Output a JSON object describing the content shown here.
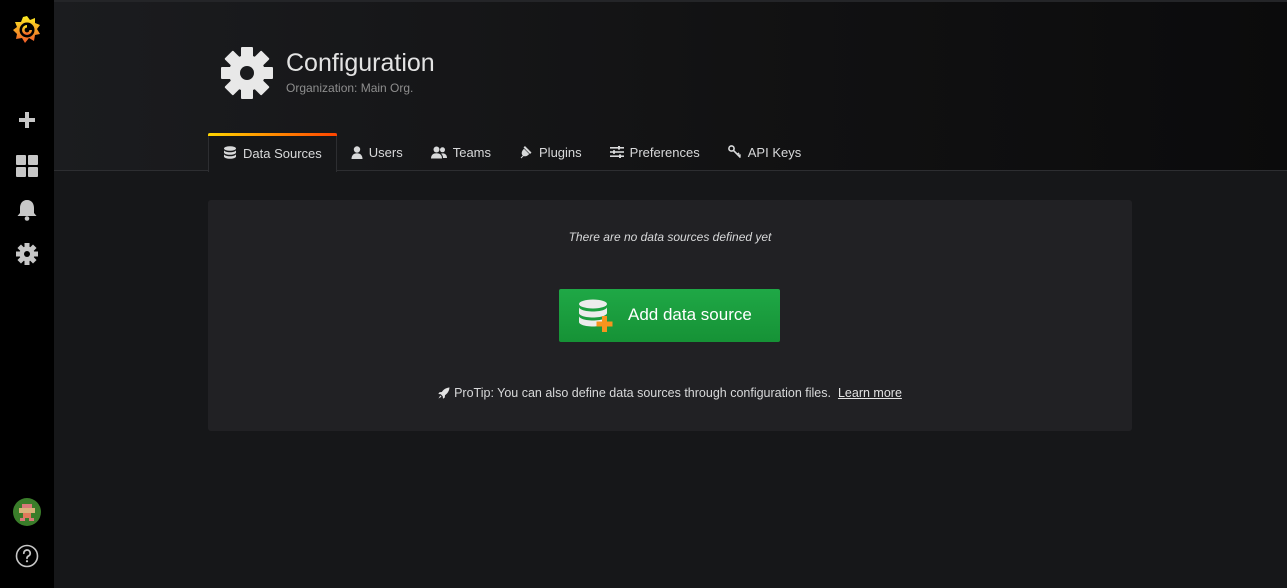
{
  "sidebar": {
    "logo_icon": "grafana-logo-icon",
    "items": [
      {
        "name": "create",
        "icon": "plus-icon"
      },
      {
        "name": "dashboards",
        "icon": "apps-icon"
      },
      {
        "name": "alerting",
        "icon": "bell-icon"
      },
      {
        "name": "configuration",
        "icon": "gear-icon"
      }
    ],
    "bottom": [
      {
        "name": "profile",
        "icon": "avatar"
      },
      {
        "name": "help",
        "icon": "question-circle-icon"
      }
    ]
  },
  "header": {
    "title": "Configuration",
    "subtitle": "Organization: Main Org.",
    "icon": "gear-icon"
  },
  "tabs": [
    {
      "label": "Data Sources",
      "icon": "database-icon",
      "active": true
    },
    {
      "label": "Users",
      "icon": "user-icon",
      "active": false
    },
    {
      "label": "Teams",
      "icon": "users-icon",
      "active": false
    },
    {
      "label": "Plugins",
      "icon": "plug-icon",
      "active": false
    },
    {
      "label": "Preferences",
      "icon": "sliders-icon",
      "active": false
    },
    {
      "label": "API Keys",
      "icon": "key-icon",
      "active": false
    }
  ],
  "empty_state": {
    "title": "There are no data sources defined yet",
    "button_label": "Add data source",
    "button_icon": "database-plus-icon",
    "protip_icon": "rocket-icon",
    "protip_text": "ProTip: You can also define data sources through configuration files.",
    "learn_more": "Learn more"
  },
  "colors": {
    "accent_gradient_start": "#ffd500",
    "accent_gradient_end": "#ff4400",
    "button_green": "#1a9c3d",
    "plus_orange": "#f7941d"
  }
}
